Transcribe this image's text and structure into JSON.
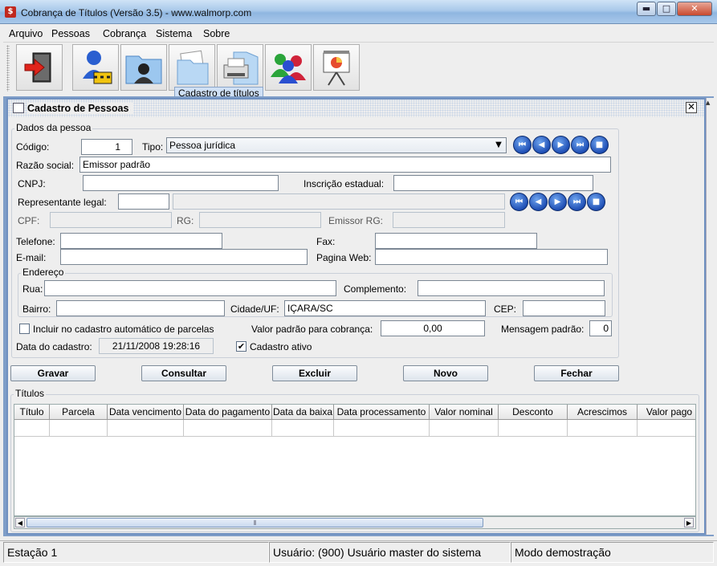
{
  "window": {
    "title": "Cobrança de Títulos (Versão 3.5) - www.walmorp.com",
    "minimize": "▬",
    "maximize": "□",
    "close": "✕"
  },
  "menu": [
    {
      "label": "Arquivo"
    },
    {
      "label": "Pessoas"
    },
    {
      "label": "Cobrança"
    },
    {
      "label": "Sistema"
    },
    {
      "label": "Sobre"
    }
  ],
  "toolbar": {
    "buttons": [
      {
        "icon": "exit-door-icon"
      },
      {
        "icon": "person-security-icon"
      },
      {
        "icon": "contact-folder-icon"
      },
      {
        "icon": "document-folder-icon"
      },
      {
        "icon": "printer-icon"
      },
      {
        "icon": "users-group-icon"
      },
      {
        "icon": "presentation-chart-icon"
      }
    ],
    "tooltip": "Cadastro de títulos"
  },
  "form": {
    "title": "Cadastro de Pessoas",
    "close": "✕",
    "dados_group": "Dados da pessoa",
    "codigo_label": "Código:",
    "codigo_value": "1",
    "tipo_label": "Tipo:",
    "tipo_value": "Pessoa jurídica",
    "razao_label": "Razão social:",
    "razao_value": "Emissor padrão",
    "cnpj_label": "CNPJ:",
    "cnpj_value": "",
    "ie_label": "Inscrição estadual:",
    "ie_value": "",
    "rep_label": "Representante legal:",
    "rep_value": "",
    "rep_name": "",
    "cpf_label": "CPF:",
    "cpf_value": "",
    "rg_label": "RG:",
    "rg_value": "",
    "emissor_rg_label": "Emissor RG:",
    "emissor_rg_value": "",
    "telefone_label": "Telefone:",
    "telefone_value": "",
    "fax_label": "Fax:",
    "fax_value": "",
    "email_label": "E-mail:",
    "email_value": "",
    "web_label": "Pagina Web:",
    "web_value": "",
    "endereco_group": "Endereço",
    "rua_label": "Rua:",
    "rua_value": "",
    "complemento_label": "Complemento:",
    "complemento_value": "",
    "bairro_label": "Bairro:",
    "bairro_value": "",
    "cidade_label": "Cidade/UF:",
    "cidade_value": "IÇARA/SC",
    "cep_label": "CEP:",
    "cep_value": "",
    "incluir_label": "Incluir no cadastro automático de parcelas",
    "incluir_checked": false,
    "valor_label": "Valor padrão para cobrança:",
    "valor_value": "0,00",
    "mensagem_label": "Mensagem padrão:",
    "mensagem_value": "0",
    "data_label": "Data do cadastro:",
    "data_value": "21/11/2008 19:28:16",
    "ativo_label": "Cadastro ativo",
    "ativo_checked": true,
    "check_mark": "✔"
  },
  "nav_buttons": [
    "⏮",
    "◀",
    "▶",
    "⏭",
    "■"
  ],
  "actions": {
    "gravar": "Gravar",
    "consultar": "Consultar",
    "excluir": "Excluir",
    "novo": "Novo",
    "fechar": "Fechar"
  },
  "titulos": {
    "group": "Títulos",
    "columns": [
      "Título",
      "Parcela",
      "Data vencimento",
      "Data do pagamento",
      "Data da baixa",
      "Data processamento",
      "Valor nominal",
      "Desconto",
      "Acrescimos",
      "Valor pago"
    ],
    "rows": []
  },
  "scroll": {
    "left": "◀",
    "right": "▶",
    "grip": "⦀",
    "up": "▲"
  },
  "status": {
    "station": "Estação 1",
    "user": "Usuário: (900) Usuário master do sistema",
    "mode": "Modo demostração"
  }
}
